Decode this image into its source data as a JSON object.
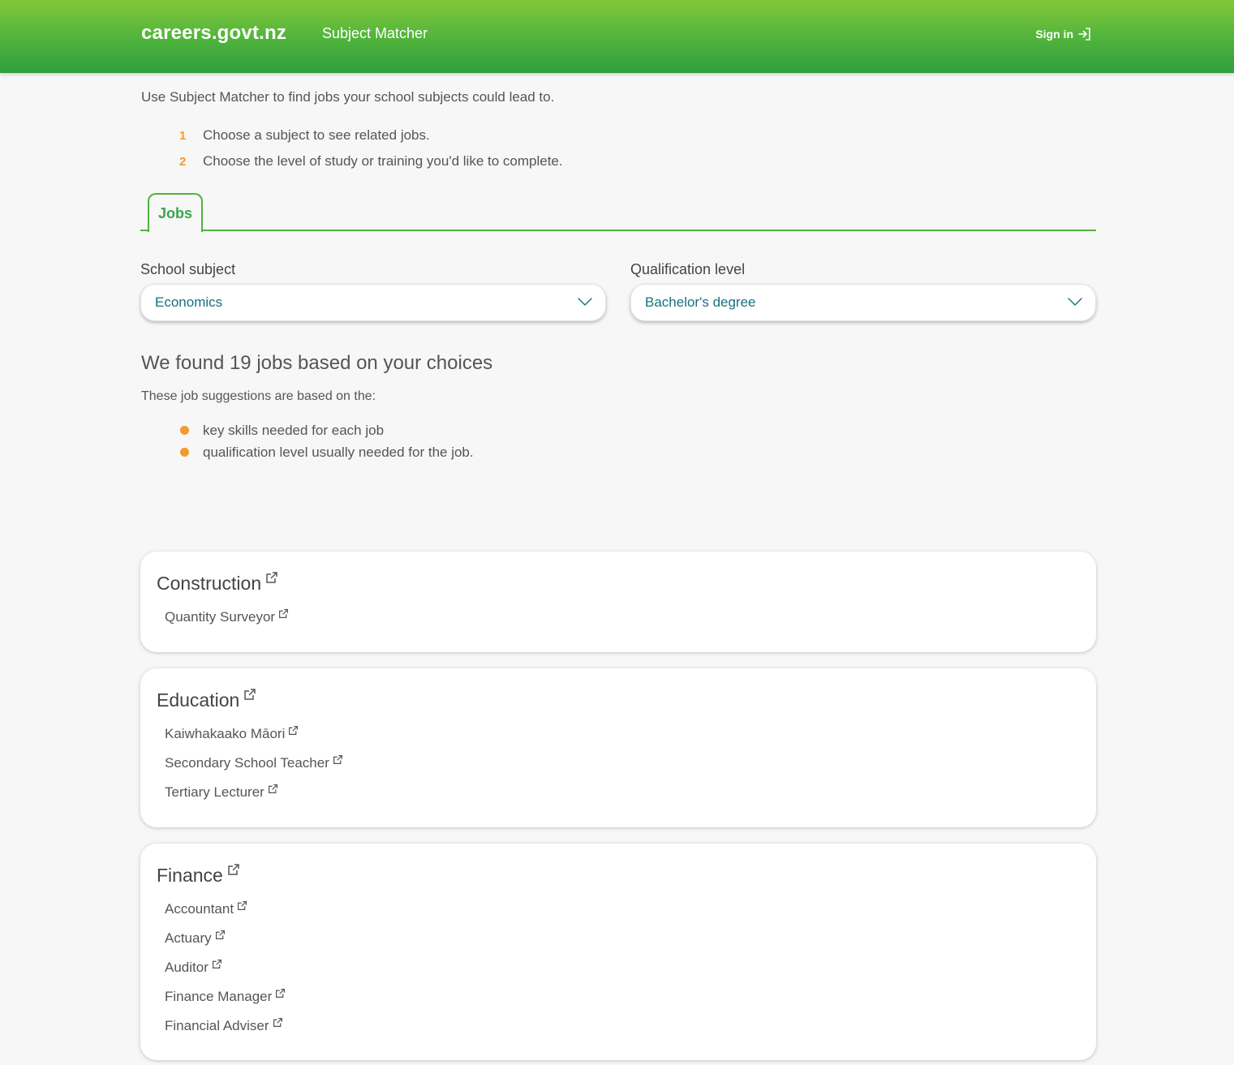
{
  "header": {
    "logo": "careers.govt.nz",
    "app_name": "Subject Matcher",
    "sign_in": "Sign in"
  },
  "intro": {
    "text": "Use Subject Matcher to find jobs your school subjects could lead to.",
    "steps": [
      {
        "num": "1",
        "text": "Choose a subject to see related jobs."
      },
      {
        "num": "2",
        "text": "Choose the level of study or training you'd like to complete."
      }
    ]
  },
  "tabs": [
    {
      "label": "Jobs"
    }
  ],
  "filters": {
    "subject": {
      "label": "School subject",
      "value": "Economics"
    },
    "qualification": {
      "label": "Qualification level",
      "value": "Bachelor's degree"
    }
  },
  "results": {
    "title": "We found 19 jobs based on your choices",
    "subtitle": "These job suggestions are based on the:",
    "bullets": [
      "key skills needed for each job",
      "qualification level usually needed for the job."
    ]
  },
  "categories": [
    {
      "title": "Construction",
      "jobs": [
        "Quantity Surveyor"
      ]
    },
    {
      "title": "Education",
      "jobs": [
        "Kaiwhakaako Māori",
        "Secondary School Teacher",
        "Tertiary Lecturer"
      ]
    },
    {
      "title": "Finance",
      "jobs": [
        "Accountant",
        "Actuary",
        "Auditor",
        "Finance Manager",
        "Financial Adviser"
      ]
    }
  ],
  "colors": {
    "header_green": "#4fb33c",
    "accent_orange": "#f39a2d",
    "select_text_teal": "#17717e"
  },
  "icons": {
    "sign_in": "sign-in-arrow-icon",
    "dropdown": "chevron-down-icon",
    "link": "external-link-icon"
  }
}
